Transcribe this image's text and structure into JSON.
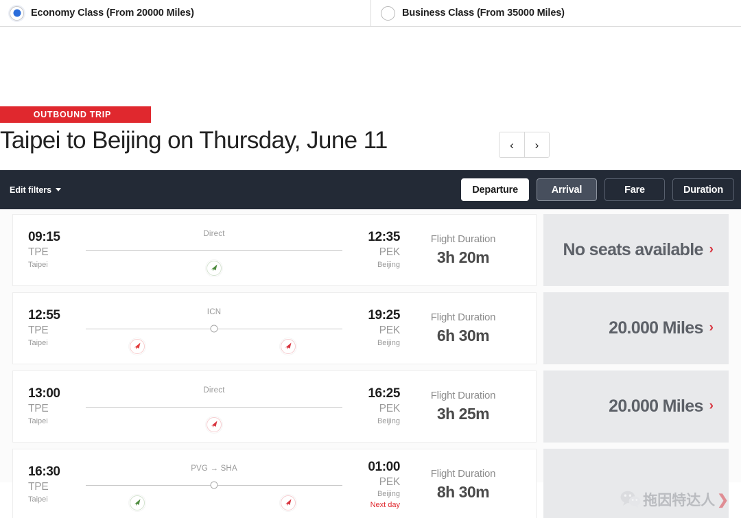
{
  "cabin_selector": {
    "options": [
      {
        "label": "Economy Class (From 20000 Miles)",
        "selected": true
      },
      {
        "label": "Business Class (From 35000 Miles)",
        "selected": false
      }
    ]
  },
  "trip_header": {
    "badge": "OUTBOUND TRIP",
    "title": "Taipei to Beijing on Thursday, June 11",
    "prev_day_icon": "‹",
    "next_day_icon": "›"
  },
  "sort_bar": {
    "edit_filters_label": "Edit filters",
    "buttons": [
      {
        "label": "Departure",
        "state": "active"
      },
      {
        "label": "Arrival",
        "state": "hovered"
      },
      {
        "label": "Fare",
        "state": "default"
      },
      {
        "label": "Duration",
        "state": "default"
      }
    ]
  },
  "flights": [
    {
      "depart_time": "09:15",
      "depart_code": "TPE",
      "depart_city": "Taipei",
      "stops_label": "Direct",
      "arrive_time": "12:35",
      "arrive_code": "PEK",
      "arrive_city": "Beijing",
      "next_day": "",
      "duration_label": "Flight Duration",
      "duration_value": "3h 20m",
      "price": "No seats available",
      "chevron": "›",
      "has_stop_dot": false,
      "carriers": [
        {
          "color": "#4f8c3f",
          "position": 50
        }
      ]
    },
    {
      "depart_time": "12:55",
      "depart_code": "TPE",
      "depart_city": "Taipei",
      "stops_label": "ICN",
      "arrive_time": "19:25",
      "arrive_code": "PEK",
      "arrive_city": "Beijing",
      "next_day": "",
      "duration_label": "Flight Duration",
      "duration_value": "6h 30m",
      "price": "20.000 Miles",
      "chevron": "›",
      "has_stop_dot": true,
      "carriers": [
        {
          "color": "#e23b3b",
          "position": 21
        },
        {
          "color": "#d8343f",
          "position": 78
        }
      ]
    },
    {
      "depart_time": "13:00",
      "depart_code": "TPE",
      "depart_city": "Taipei",
      "stops_label": "Direct",
      "arrive_time": "16:25",
      "arrive_code": "PEK",
      "arrive_city": "Beijing",
      "next_day": "",
      "duration_label": "Flight Duration",
      "duration_value": "3h 25m",
      "price": "20.000 Miles",
      "chevron": "›",
      "has_stop_dot": false,
      "carriers": [
        {
          "color": "#d8343f",
          "position": 50
        }
      ]
    },
    {
      "depart_time": "16:30",
      "depart_code": "TPE",
      "depart_city": "Taipei",
      "stops_label": "PVG → SHA",
      "arrive_time": "01:00",
      "arrive_code": "PEK",
      "arrive_city": "Beijing",
      "next_day": "Next day",
      "duration_label": "Flight Duration",
      "duration_value": "8h 30m",
      "price": "",
      "chevron": "",
      "has_stop_dot": true,
      "carriers": [
        {
          "color": "#4f8c3f",
          "position": 21
        },
        {
          "color": "#d8343f",
          "position": 78
        }
      ]
    }
  ],
  "watermark": {
    "text": "拖因特达人",
    "arrow": "❯"
  },
  "colors": {
    "accent_red": "#e0282e",
    "toolbar_dark": "#232a36",
    "price_panel": "#e8e9eb",
    "radio_blue": "#2a6ddb"
  }
}
